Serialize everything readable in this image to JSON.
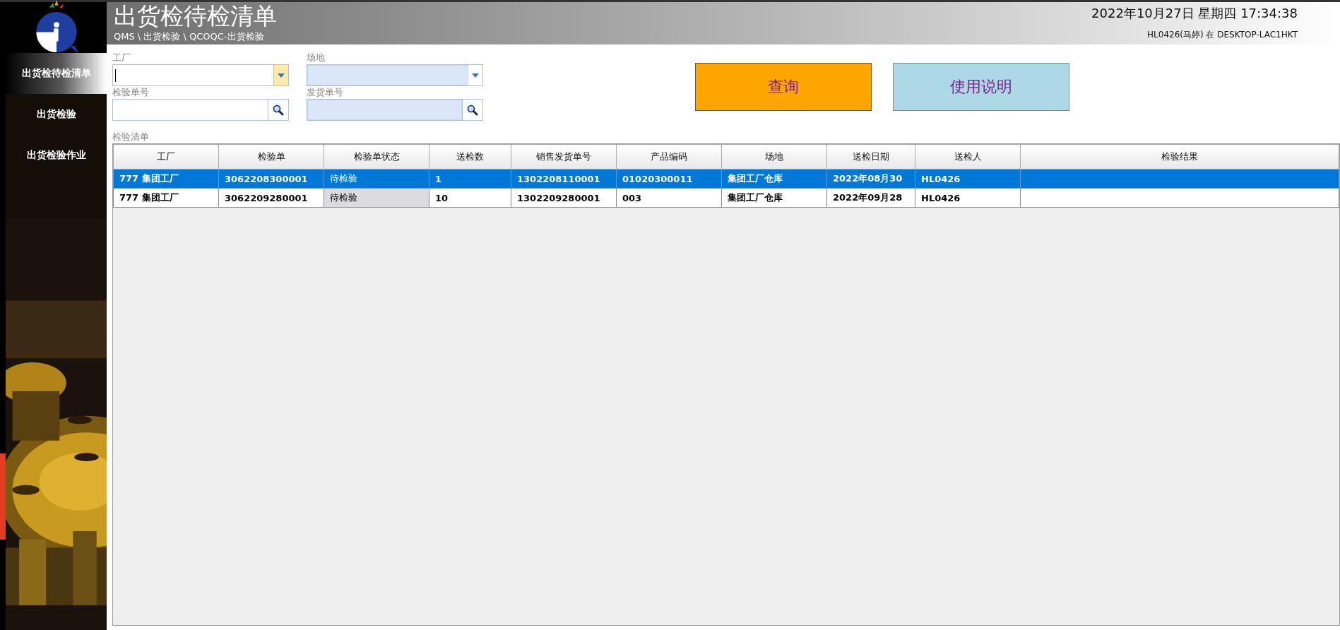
{
  "header": {
    "title": "出货检待检清单",
    "breadcrumb": "QMS \\ 出货检验 \\ QCOQC-出货检验",
    "datetime": "2022年10月27日 星期四 17:34:38",
    "user": "HL0426(马婷) 在 DESKTOP-LAC1HKT"
  },
  "sidebar": {
    "items": [
      {
        "label": "出货检待检清单",
        "selected": true
      },
      {
        "label": "出货检验",
        "selected": false
      },
      {
        "label": "出货检验作业",
        "selected": false
      }
    ]
  },
  "filters": [
    {
      "label": "工厂",
      "kind": "dropdown",
      "disabled": false,
      "focused": true
    },
    {
      "label": "场地",
      "kind": "dropdown",
      "disabled": true,
      "focused": false
    },
    {
      "label": "检验单号",
      "kind": "lookup",
      "disabled": false,
      "focused": false
    },
    {
      "label": "发货单号",
      "kind": "lookup",
      "disabled": true,
      "focused": false
    }
  ],
  "buttons": [
    {
      "label": "查询",
      "kind": "primary"
    },
    {
      "label": "使用说明",
      "kind": "secondary"
    }
  ],
  "table": {
    "title": "检验清单",
    "columns": [
      "工厂",
      "检验单",
      "检验单状态",
      "送检数",
      "销售发货单号",
      "产品编码",
      "场地",
      "送检日期",
      "送检人",
      "检验结果"
    ],
    "rows": [
      {
        "selected": true,
        "status_highlighted": false,
        "cells": [
          "777 集团工厂",
          "3062208300001",
          "待检验",
          "1",
          "1302208110001",
          "01020300011",
          "集团工厂仓库",
          "2022年08月30",
          "HL0426",
          ""
        ]
      },
      {
        "selected": false,
        "status_highlighted": true,
        "cells": [
          "777 集团工厂",
          "3062209280001",
          "待检验",
          "10",
          "1302209280001",
          "003",
          "集团工厂仓库",
          "2022年09月28",
          "HL0426",
          ""
        ]
      }
    ]
  }
}
